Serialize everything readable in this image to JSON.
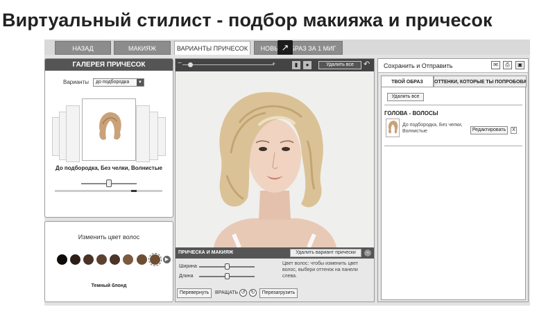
{
  "header": {
    "title": "Виртуальный стилист - подбор макияжа и причесок"
  },
  "tabs": [
    {
      "label": "НАЗАД"
    },
    {
      "label": "МАКИЯЖ"
    },
    {
      "label": "ВАРИАНТЫ ПРИЧЕСОК",
      "active": true
    },
    {
      "label": "НОВЫЙ ОБРАЗ ЗА 1 МИГ"
    }
  ],
  "popout": {
    "icon": "external-link-icon"
  },
  "gallery": {
    "title": "ГАЛЕРЕЯ ПРИЧЕСОК",
    "variants_label": "Варианты",
    "variants_value": "до подбородка",
    "caption": "До подбородка, Без челки, Волнистые"
  },
  "colors": {
    "title": "Изменить цвет волос",
    "swatches": [
      "#0e0b09",
      "#2d1f17",
      "#4a3326",
      "#5d4130",
      "#4b3528",
      "#7b5a3e",
      "#6e4e33",
      "#6f5035"
    ],
    "selected_index": 7,
    "caption": "Темный блонд"
  },
  "toolbar": {
    "minus": "−",
    "plus": "+",
    "remove_all": "Удалить все",
    "zoom_level": 0.08
  },
  "controls": {
    "title": "ПРИЧЕСКА И МАКИЯЖ",
    "remove_variant": "Удалить вариант прически",
    "width_label": "Ширина",
    "length_label": "Длина",
    "width_value": 0.5,
    "length_value": 0.5,
    "hint": "Цвет волос: чтобы изменить цвет волос, выбери оттенок на панели слева.",
    "flip_button": "Перевернуть",
    "rotate_label": "ВРАЩАТЬ",
    "reload_button": "Перезагрузить"
  },
  "right": {
    "save_label": "Сохранить и Отправить",
    "tab_look": "ТВОЙ ОБРАЗ",
    "tab_tried": "ОТТЕНКИ, КОТОРЫЕ ТЫ ПОПРОБОВАЛА",
    "remove_all": "Удалить все",
    "section": "ГОЛОВА - ВОЛОСЫ",
    "item": "До подбородка, Без челки, Волнистые",
    "edit_button": "Редактировать",
    "delete": "X"
  }
}
